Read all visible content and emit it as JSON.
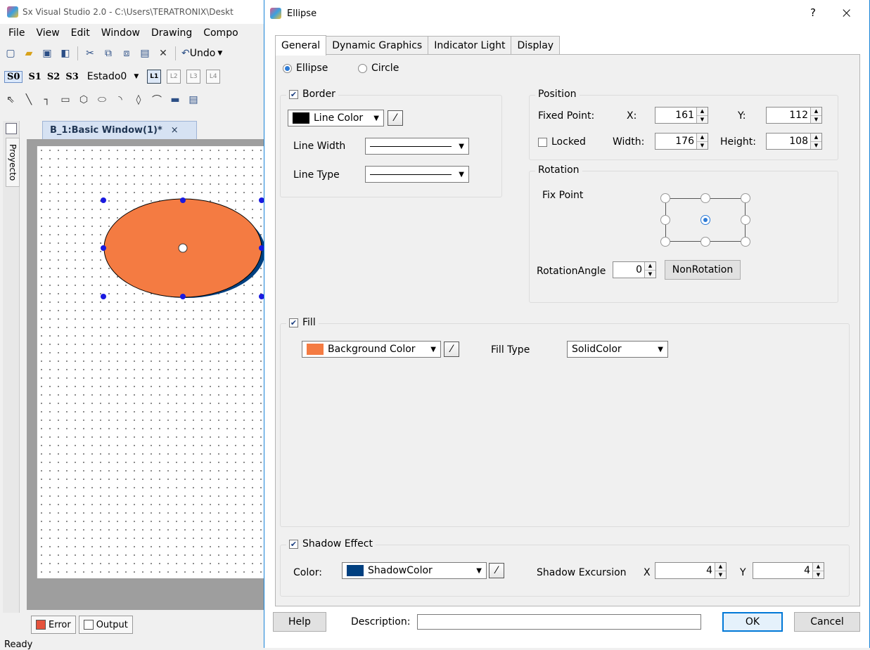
{
  "app": {
    "title": "Sx Visual Studio 2.0 - C:\\Users\\TERATRONIX\\Deskt",
    "menu": [
      "File",
      "View",
      "Edit",
      "Window",
      "Drawing",
      "Compo"
    ],
    "toolbar1": {
      "undo_label": "Undo"
    },
    "toolbar2": {
      "states": [
        "S0",
        "S1",
        "S2",
        "S3"
      ],
      "state_select": "Estado0",
      "layers": [
        "L1",
        "L2",
        "L3",
        "L4"
      ]
    },
    "side_panel_label": "Proyecto",
    "doc_tab": "B_1:Basic Window(1)*",
    "doc_tab_close": "×",
    "bottom_tabs": [
      "Error",
      "Output"
    ],
    "status": "Ready",
    "ellipse_shape": {
      "fill": "#f47b42",
      "shadow": "#004080"
    }
  },
  "dialog": {
    "title": "Ellipse",
    "help_glyph": "?",
    "close_glyph": "×",
    "tabs": [
      "General",
      "Dynamic Graphics",
      "Indicator Light",
      "Display"
    ],
    "active_tab": "General",
    "shape": {
      "ellipse_label": "Ellipse",
      "circle_label": "Circle",
      "selected": "Ellipse"
    },
    "border": {
      "label": "Border",
      "checked": true,
      "line_color_label": "Line Color",
      "line_color": "#000000",
      "line_width_label": "Line Width",
      "line_type_label": "Line Type"
    },
    "position": {
      "label": "Position",
      "fixed_point_label": "Fixed Point:",
      "x_label": "X:",
      "x": "161",
      "y_label": "Y:",
      "y": "112",
      "locked_label": "Locked",
      "locked": false,
      "width_label": "Width:",
      "width": "176",
      "height_label": "Height:",
      "height": "108"
    },
    "rotation": {
      "label": "Rotation",
      "fix_point_label": "Fix Point",
      "angle_label": "RotationAngle",
      "angle": "0",
      "nonrotation_label": "NonRotation",
      "selected_point": "center"
    },
    "fill": {
      "label": "Fill",
      "checked": true,
      "bg_color_label": "Background Color",
      "bg_color": "#f47b42",
      "fill_type_label": "Fill Type",
      "fill_type": "SolidColor"
    },
    "shadow": {
      "label": "Shadow Effect",
      "checked": true,
      "color_label": "Color:",
      "color_name": "ShadowColor",
      "color": "#004080",
      "excursion_label": "Shadow Excursion",
      "x_label": "X",
      "x": "4",
      "y_label": "Y",
      "y": "4"
    },
    "footer": {
      "help_label": "Help",
      "description_label": "Description:",
      "description_value": "",
      "ok_label": "OK",
      "cancel_label": "Cancel"
    }
  }
}
